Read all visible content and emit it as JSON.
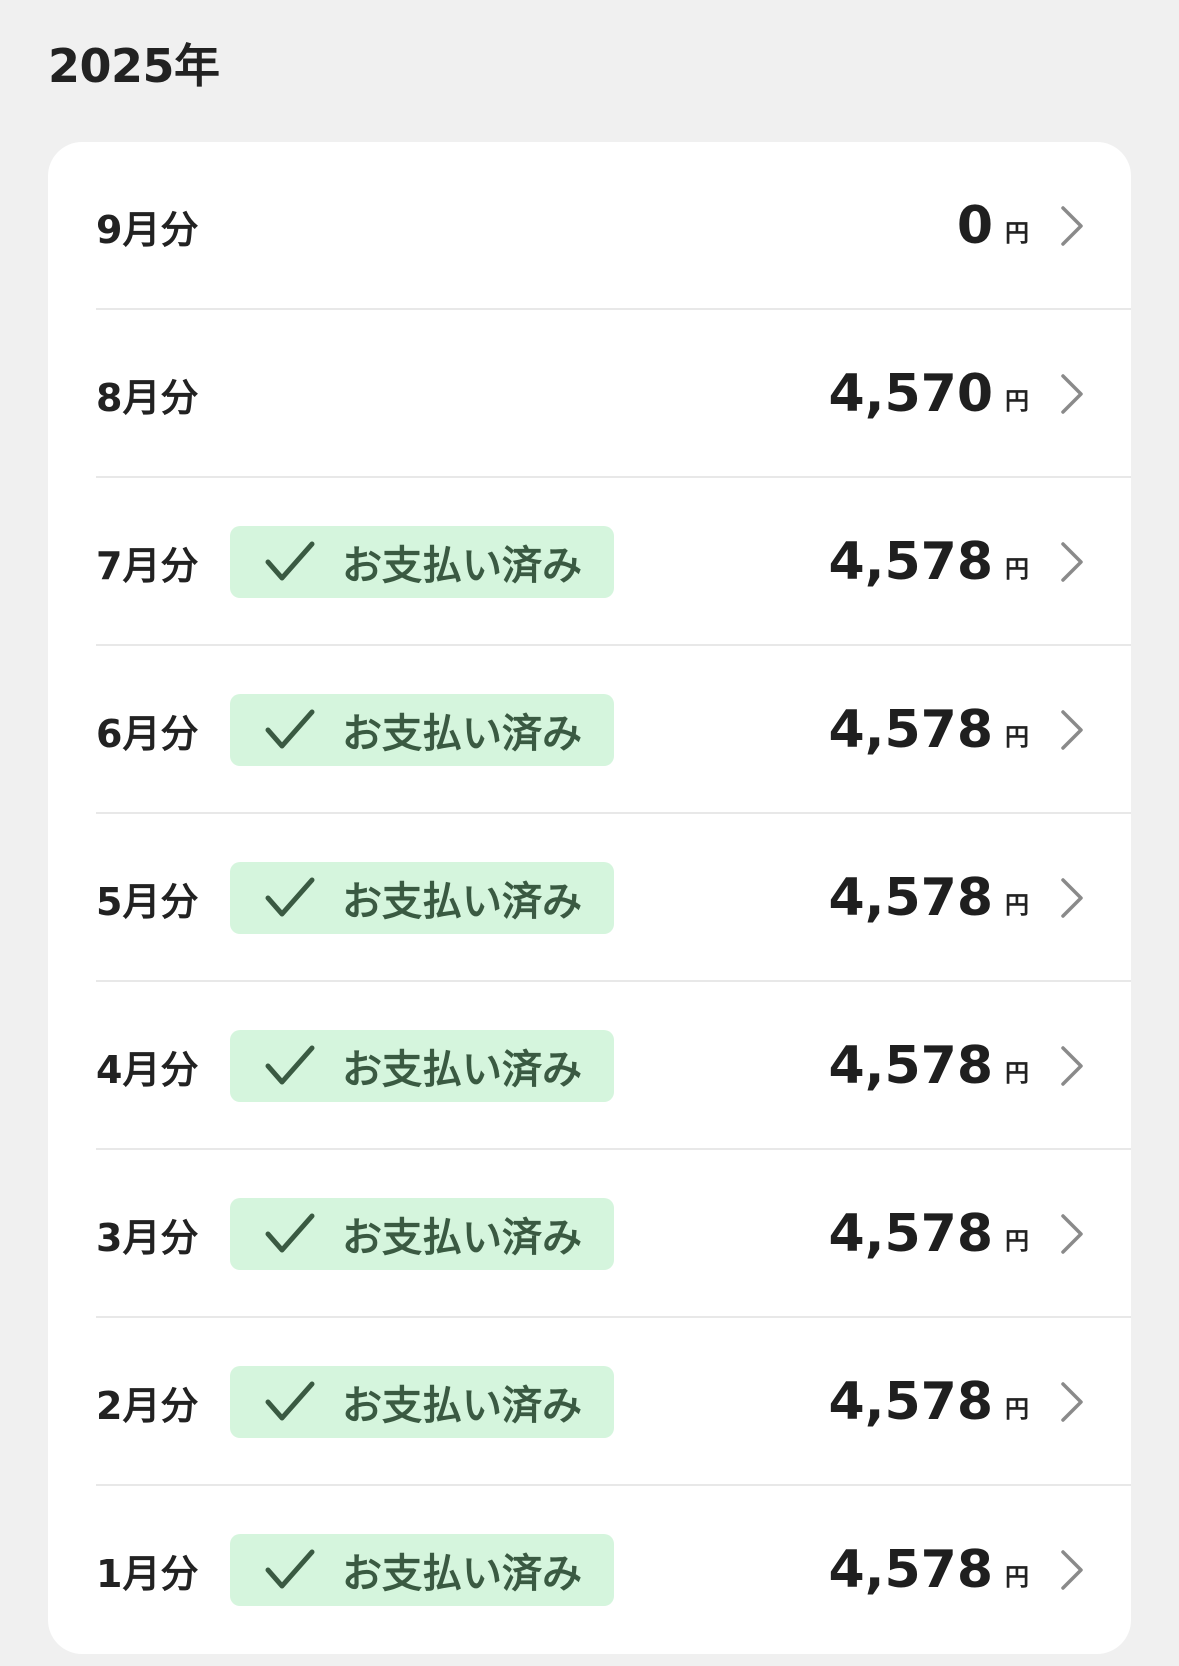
{
  "section": {
    "year_label": "2025年"
  },
  "colors": {
    "background": "#f0f0f0",
    "card": "#ffffff",
    "badge_bg": "#d5f5dd",
    "badge_text": "#3a5a42",
    "divider": "#e8e8e8"
  },
  "rows": [
    {
      "month": "9月分",
      "status": "",
      "amount": "0",
      "currency": "円"
    },
    {
      "month": "8月分",
      "status": "",
      "amount": "4,570",
      "currency": "円"
    },
    {
      "month": "7月分",
      "status": "お支払い済み",
      "amount": "4,578",
      "currency": "円"
    },
    {
      "month": "6月分",
      "status": "お支払い済み",
      "amount": "4,578",
      "currency": "円"
    },
    {
      "month": "5月分",
      "status": "お支払い済み",
      "amount": "4,578",
      "currency": "円"
    },
    {
      "month": "4月分",
      "status": "お支払い済み",
      "amount": "4,578",
      "currency": "円"
    },
    {
      "month": "3月分",
      "status": "お支払い済み",
      "amount": "4,578",
      "currency": "円"
    },
    {
      "month": "2月分",
      "status": "お支払い済み",
      "amount": "4,578",
      "currency": "円"
    },
    {
      "month": "1月分",
      "status": "お支払い済み",
      "amount": "4,578",
      "currency": "円"
    }
  ],
  "icons": {
    "status": "check-icon",
    "row": "chevron-right-icon"
  }
}
